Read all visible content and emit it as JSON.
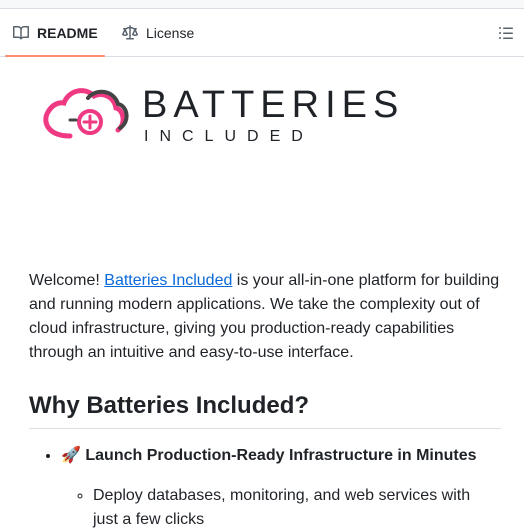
{
  "tabs": [
    {
      "label": "README",
      "icon": "book-icon",
      "active": true
    },
    {
      "label": "License",
      "icon": "scale-icon",
      "active": false
    }
  ],
  "outline_button": {
    "icon": "list-unordered-icon"
  },
  "logo": {
    "word_top": "BATTERIES",
    "word_bottom": "INCLUDED",
    "colors": {
      "pink": "#ef3a83",
      "grey": "#444444"
    }
  },
  "intro": {
    "prefix": "Welcome! ",
    "link": "Batteries Included",
    "suffix": " is your all-in-one platform for building and running modern applications. We take the complexity out of cloud infrastructure, giving you production-ready capabilities through an intuitive and easy-to-use interface."
  },
  "heading": "Why Batteries Included?",
  "features": [
    {
      "emoji": "🚀",
      "title": "Launch Production-Ready Infrastructure in Minutes",
      "items": [
        "Deploy databases, monitoring, and web services with just a few clicks"
      ]
    }
  ],
  "colors": {
    "link": "#0969da",
    "active_tab_underline": "#fd8c73",
    "border": "#d8dee4"
  }
}
